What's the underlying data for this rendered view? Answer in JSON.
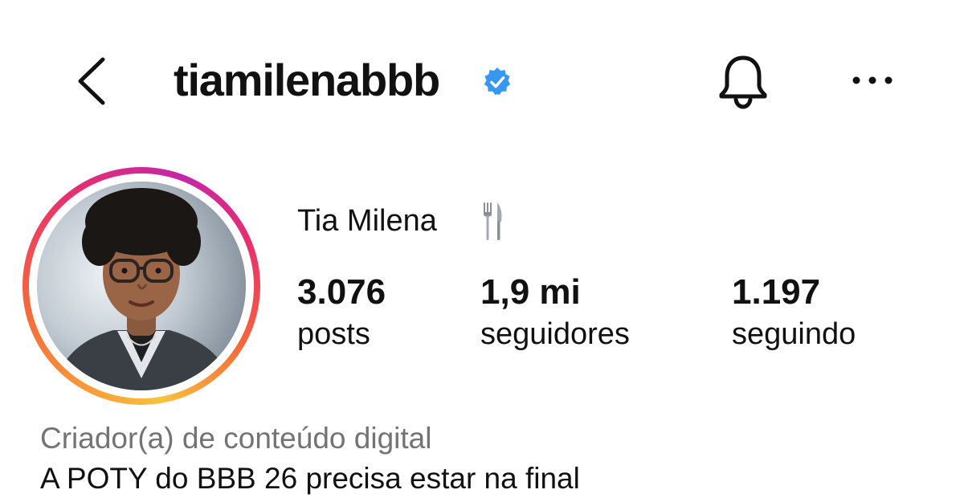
{
  "header": {
    "username": "tiamilenabbb",
    "verified": true,
    "back_icon": "chevron-left-icon",
    "notifications_icon": "bell-icon",
    "more_icon": "ellipsis-horizontal-icon"
  },
  "profile": {
    "display_name": "Tia Milena",
    "name_emoji_icon": "fork-and-knife-icon",
    "avatar_icon": "profile-photo",
    "story_ring": true,
    "stats": {
      "posts": {
        "value": "3.076",
        "label": "posts"
      },
      "followers": {
        "value": "1,9 mi",
        "label": "seguidores"
      },
      "following": {
        "value": "1.197",
        "label": "seguindo"
      }
    },
    "category": "Criador(a) de conteúdo digital",
    "bio": "A POTY do BBB 26 precisa estar na final"
  },
  "colors": {
    "text": "#111111",
    "secondary_text": "#737373",
    "verified_badge": "#3897f0",
    "story_ring": [
      "#f9a23a",
      "#f4673b",
      "#e8306c",
      "#c426a8",
      "#f8c23c"
    ]
  }
}
